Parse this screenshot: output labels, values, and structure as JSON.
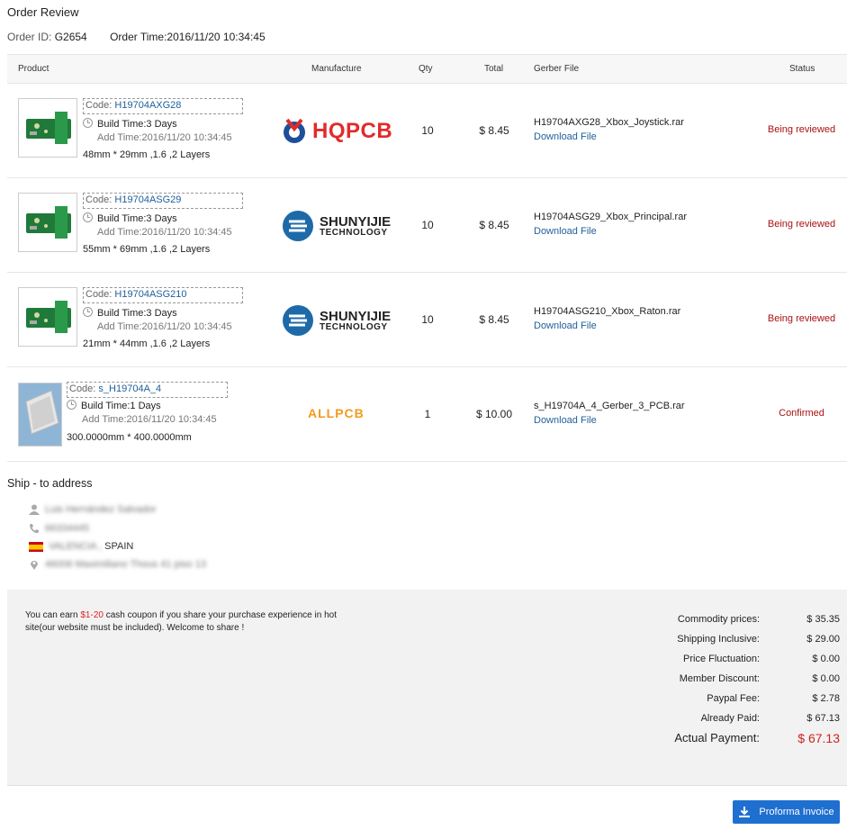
{
  "header": {
    "title": "Order Review",
    "order_id_label": "Order ID:",
    "order_id": "G2654",
    "order_time_label": "Order Time:",
    "order_time": "2016/11/20 10:34:45"
  },
  "table": {
    "columns": [
      "Product",
      "Manufacture",
      "Qty",
      "Total",
      "Gerber File",
      "Status"
    ],
    "rows": [
      {
        "code_label": "Code:",
        "code": "H19704AXG28",
        "build_time": "Build Time:3 Days",
        "add_time": "Add Time:2016/11/20 10:34:45",
        "dims": "48mm * 29mm ,1.6 ,2 Layers",
        "manufacturer": "HQPCB",
        "qty": "10",
        "total": "$ 8.45",
        "gerber_file": "H19704AXG28_Xbox_Joystick.rar",
        "download_label": "Download File",
        "status": "Being reviewed"
      },
      {
        "code_label": "Code:",
        "code": "H19704ASG29",
        "build_time": "Build Time:3 Days",
        "add_time": "Add Time:2016/11/20 10:34:45",
        "dims": "55mm * 69mm ,1.6 ,2 Layers",
        "manufacturer": "SHUNYIJIE TECHNOLOGY",
        "qty": "10",
        "total": "$ 8.45",
        "gerber_file": "H19704ASG29_Xbox_Principal.rar",
        "download_label": "Download File",
        "status": "Being reviewed"
      },
      {
        "code_label": "Code:",
        "code": "H19704ASG210",
        "build_time": "Build Time:3 Days",
        "add_time": "Add Time:2016/11/20 10:34:45",
        "dims": "21mm * 44mm ,1.6 ,2 Layers",
        "manufacturer": "SHUNYIJIE TECHNOLOGY",
        "qty": "10",
        "total": "$ 8.45",
        "gerber_file": "H19704ASG210_Xbox_Raton.rar",
        "download_label": "Download File",
        "status": "Being reviewed"
      },
      {
        "code_label": "Code:",
        "code": "s_H19704A_4",
        "build_time": "Build Time:1 Days",
        "add_time": "Add Time:2016/11/20 10:34:45",
        "dims": "300.0000mm * 400.0000mm",
        "manufacturer": "ALLPCB",
        "qty": "1",
        "total": "$ 10.00",
        "gerber_file": "s_H19704A_4_Gerber_3_PCB.rar",
        "download_label": "Download File",
        "status": "Confirmed"
      }
    ]
  },
  "logos": {
    "hqpcb": "HQPCB",
    "shunyijie_a": "SHUNYIJIE",
    "shunyijie_b": "TECHNOLOGY",
    "allpcb": "ALLPCB"
  },
  "ship": {
    "title": "Ship - to address",
    "name": "Luis Hernández Salvador",
    "phone": "66334445",
    "city": "VALENCIA ,",
    "country": "SPAIN",
    "street": "46006 Maximiliano Thous 41 piso 13"
  },
  "summary": {
    "promo_pre": "You can earn ",
    "promo_amount": "$1-20",
    "promo_post": " cash coupon if you share your purchase experience in hot site(our website must be included). Welcome to share !",
    "rows": [
      {
        "label": "Commodity prices:",
        "value": "$ 35.35"
      },
      {
        "label": "Shipping Inclusive:",
        "value": "$ 29.00"
      },
      {
        "label": "Price Fluctuation:",
        "value": "$ 0.00"
      },
      {
        "label": "Member Discount:",
        "value": "$ 0.00"
      },
      {
        "label": "Paypal Fee:",
        "value": "$ 2.78"
      },
      {
        "label": "Already Paid:",
        "value": "$ 67.13"
      }
    ],
    "actual_label": "Actual Payment:",
    "actual_value": "$ 67.13"
  },
  "invoice_button": "Proforma Invoice",
  "colors": {
    "accent": "#1f6fd0",
    "status_red": "#aa1111",
    "link": "#1f5f9a",
    "hqpcb_red": "#e22b2b",
    "allpcb_orange": "#f39a1c"
  }
}
